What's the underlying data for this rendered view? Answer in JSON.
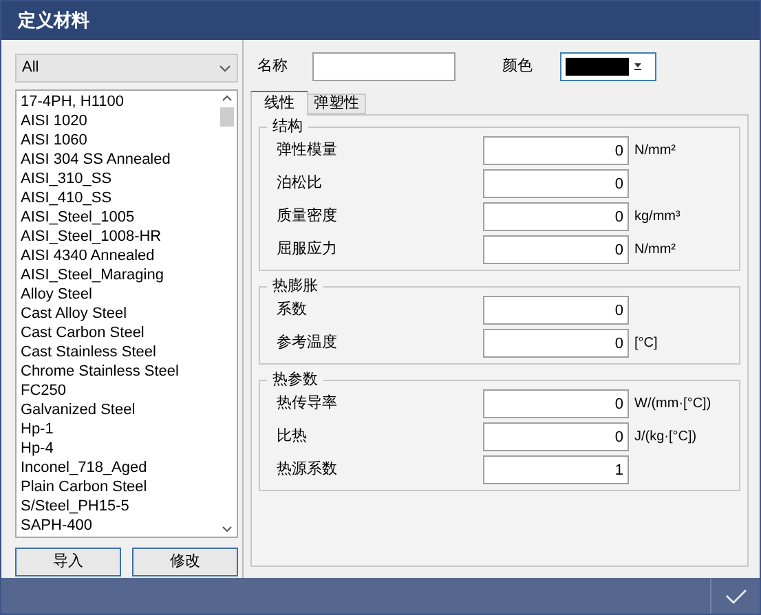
{
  "window": {
    "title": "定义材料"
  },
  "filter": {
    "value": "All"
  },
  "materials": [
    "17-4PH, H1100",
    "AISI 1020",
    "AISI 1060",
    "AISI 304 SS Annealed",
    "AISI_310_SS",
    "AISI_410_SS",
    "AISI_Steel_1005",
    "AISI_Steel_1008-HR",
    "AISI 4340 Annealed",
    "AISI_Steel_Maraging",
    "Alloy Steel",
    "Cast Alloy Steel",
    "Cast Carbon Steel",
    "Cast Stainless Steel",
    "Chrome Stainless Steel",
    "FC250",
    "Galvanized Steel",
    "Hp-1",
    "Hp-4",
    "Inconel_718_Aged",
    "Plain Carbon Steel",
    "S/Steel_PH15-5",
    "SAPH-400"
  ],
  "buttons": [
    "导入",
    "修改"
  ],
  "name": {
    "label": "名称"
  },
  "color": {
    "label": "颜色",
    "color": "#000000"
  },
  "tabs": [
    {
      "label": "线性",
      "selected": true
    },
    {
      "label": "弹塑性",
      "selected": false
    }
  ],
  "groups": [
    {
      "title": "结构",
      "fields": [
        {
          "label": "弹性模量",
          "value": "0",
          "unit": "N/mm²"
        },
        {
          "label": "泊松比",
          "value": "0"
        },
        {
          "label": "质量密度",
          "value": "0",
          "unit": "kg/mm³"
        },
        {
          "label": "屈服应力",
          "value": "0",
          "unit": "N/mm²"
        }
      ]
    },
    {
      "title": "热膨胀",
      "fields": [
        {
          "label": "系数",
          "value": "0"
        },
        {
          "label": "参考温度",
          "value": "0",
          "unit": "[°C]"
        }
      ]
    },
    {
      "title": "热参数",
      "fields": [
        {
          "label": "热传导率",
          "value": "0",
          "unit": "W/(mm·[°C])"
        },
        {
          "label": "比热",
          "value": "0",
          "unit": "J/(kg·[°C])"
        },
        {
          "label": "热源系数",
          "value": "1"
        }
      ]
    }
  ]
}
